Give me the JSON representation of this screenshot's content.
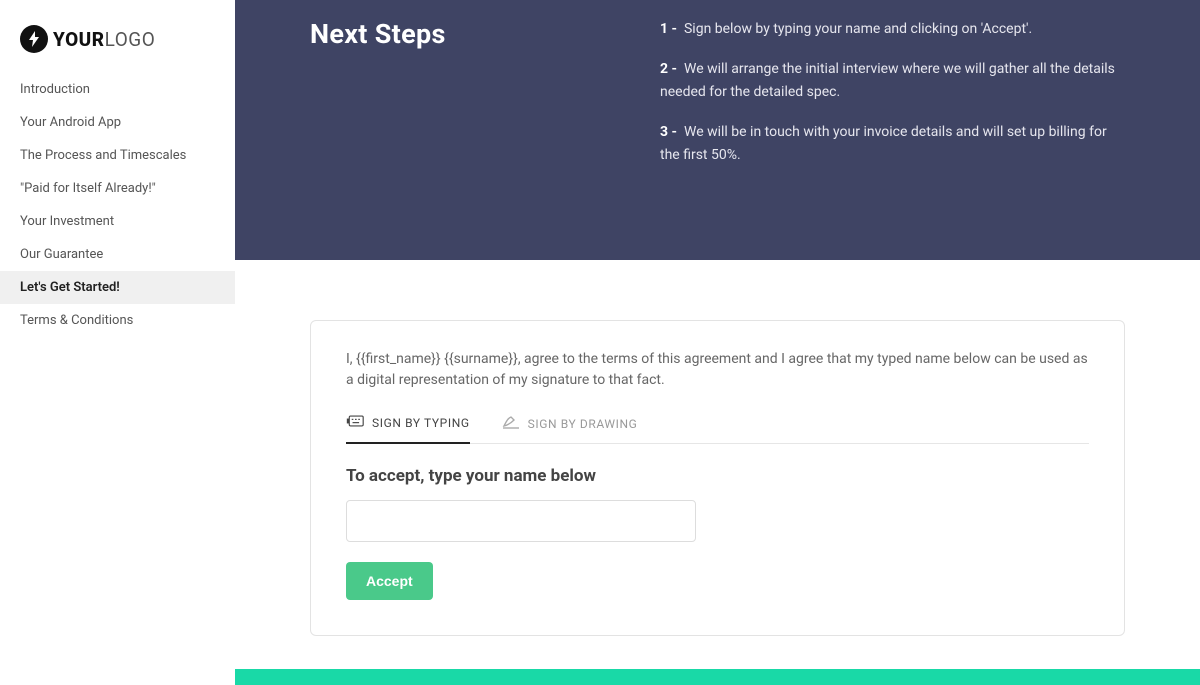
{
  "logo": {
    "bold": "YOUR",
    "light": "LOGO"
  },
  "sidebar": {
    "items": [
      {
        "label": "Introduction",
        "active": false
      },
      {
        "label": "Your Android App",
        "active": false
      },
      {
        "label": "The Process and Timescales",
        "active": false
      },
      {
        "label": "\"Paid for Itself Already!\"",
        "active": false
      },
      {
        "label": "Your Investment",
        "active": false
      },
      {
        "label": "Our Guarantee",
        "active": false
      },
      {
        "label": "Let's Get Started!",
        "active": true
      },
      {
        "label": "Terms & Conditions",
        "active": false
      }
    ]
  },
  "hero": {
    "title": "Next Steps",
    "steps": [
      {
        "num": "1  -",
        "text": "Sign below by typing your name and clicking on 'Accept'."
      },
      {
        "num": "2  -",
        "text": "We will arrange the initial interview where we will gather all the details needed for the detailed spec."
      },
      {
        "num": "3  -",
        "text": "We will be in touch with your invoice details and will set up billing for the first 50%."
      }
    ]
  },
  "sign": {
    "agree": "I, {{first_name}} {{surname}}, agree to the terms of this agreement and I agree that my typed name below can be used as a digital representation of my signature to that fact.",
    "tabs": {
      "typing": "SIGN BY TYPING",
      "drawing": "SIGN BY DRAWING"
    },
    "prompt": "To accept, type your name below",
    "accept": "Accept"
  }
}
